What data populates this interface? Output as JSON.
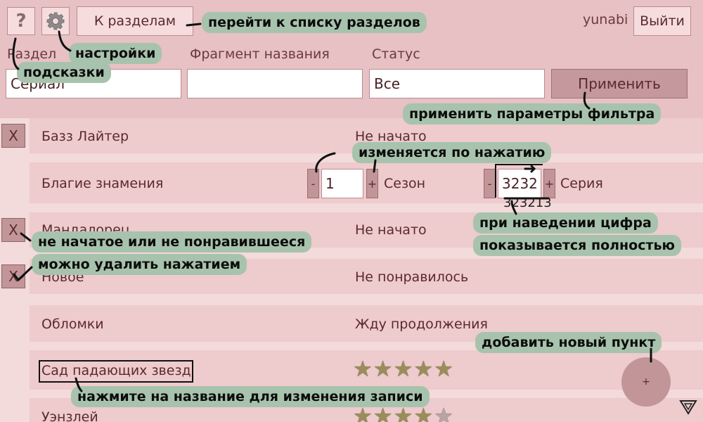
{
  "header": {
    "help_label": "?",
    "back_label": "К разделам",
    "username": "yunabi",
    "logout_label": "Выйти"
  },
  "filters": {
    "section_label": "Раздел",
    "section_value": "Сериал",
    "title_fragment_label": "Фрагмент названия",
    "title_fragment_value": "",
    "status_label": "Статус",
    "status_value": "Все",
    "apply_label": "Применить"
  },
  "rows": [
    {
      "title": "Базз Лайтер",
      "status": "Не начато",
      "delete_label": "X"
    },
    {
      "title": "Благие знамения",
      "season_minus": "-",
      "season_value": "1",
      "season_plus": "+",
      "season_label": "Сезон",
      "episode_minus": "-",
      "episode_value": "3232",
      "episode_plus": "+",
      "episode_label": "Серия",
      "episode_full": "323213"
    },
    {
      "title": "Мандалорец",
      "status": "Не начато",
      "delete_label": "X"
    },
    {
      "title": "Новое",
      "status": "Не понравилось",
      "delete_label": "X"
    },
    {
      "title": "Обломки",
      "status": "Жду продолжения"
    },
    {
      "title": "Сад падающих звезд",
      "rating": 5
    },
    {
      "title": "Уэнзлей",
      "rating": 4.5
    }
  ],
  "add_button_label": "+",
  "tutorial": {
    "back": "перейти к списку разделов",
    "settings": "настройки",
    "hints": "подсказки",
    "apply": "применить параметры фильтра",
    "clickable": "изменяется по нажатию",
    "hover": "при наведении цифра",
    "hover2": "показывается полностью",
    "delete1": "не начатое или не понравившееся",
    "delete2": "можно удалить нажатием",
    "add": "добавить новый пункт",
    "edit": "нажмите на название для изменения записи"
  },
  "colors": {
    "header_bg": "#e7c1c3",
    "row_bg": "#eecbcd",
    "page_bg": "#f3dadb",
    "accent_button": "#c29599",
    "callout": "#a8c3ad"
  },
  "icons": [
    "question-icon",
    "gear-icon",
    "star-icon",
    "dropdown-corner-icon"
  ]
}
